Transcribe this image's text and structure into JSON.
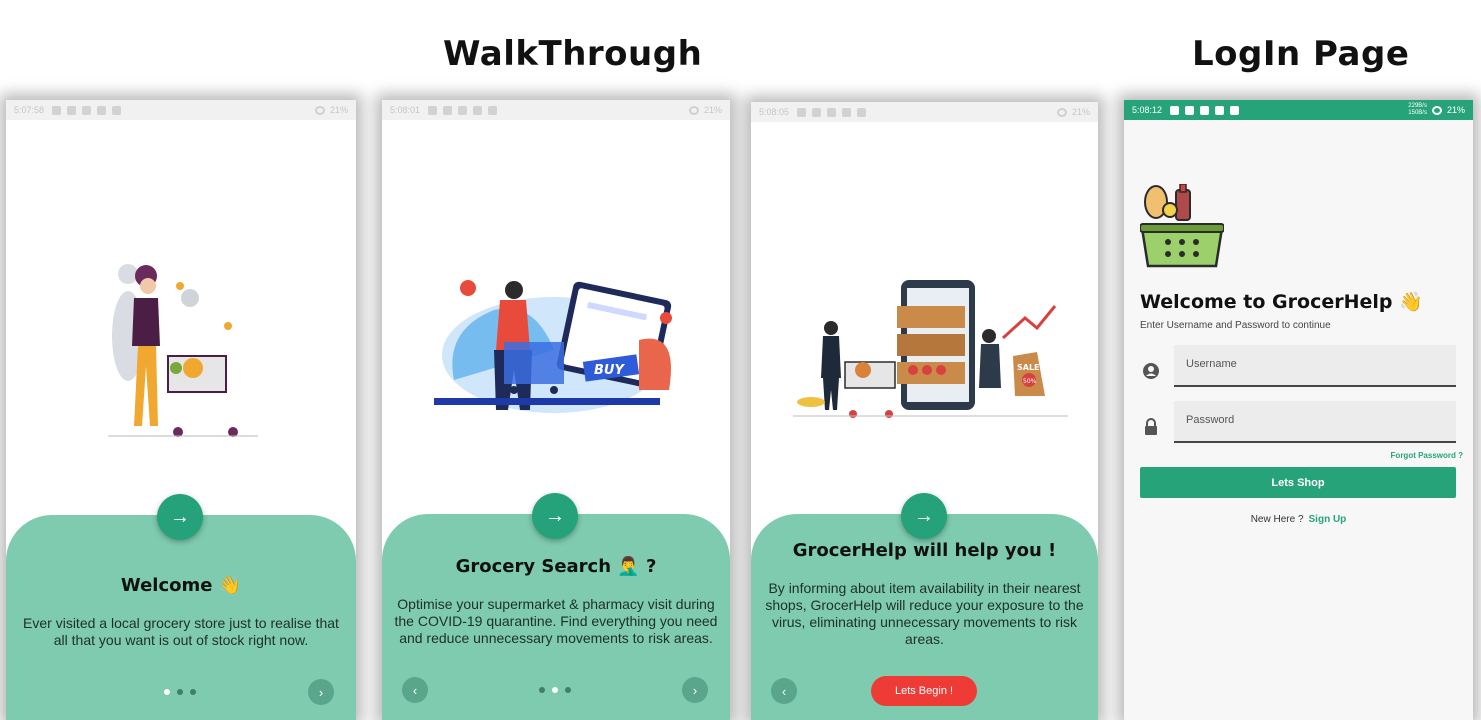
{
  "headings": {
    "walkthrough": "WalkThrough",
    "login": "LogIn Page"
  },
  "colors": {
    "accent": "#26a27b",
    "panel": "#7ecbb0",
    "begin": "#ef3b36"
  },
  "icons": {
    "next": "→",
    "prev": "‹",
    "fwd": "›"
  },
  "screens": [
    {
      "time": "5:07:58",
      "battery": "21%",
      "title": "Welcome 👋",
      "body": "Ever visited a local grocery store just to realise that all that you want is out of stock right now."
    },
    {
      "time": "5:08:01",
      "battery": "21%",
      "title": "Grocery Search 🤦‍♂️ ?",
      "body": "Optimise your supermarket & pharmacy visit during the COVID-19 quarantine. Find everything you need and reduce unnecessary movements to risk areas.",
      "illus": {
        "buy": "BUY"
      }
    },
    {
      "time": "5:08:05",
      "battery": "21%",
      "title": "GrocerHelp will help you !",
      "body": "By informing about item availability in their nearest shops, GrocerHelp will reduce your exposure to the virus, eliminating unnecessary movements to risk areas.",
      "button": "Lets Begin !",
      "illus": {
        "sale": "SALE",
        "pct": "50%"
      }
    }
  ],
  "login": {
    "time": "5:08:12",
    "battery": "21%",
    "net_up": "229B/s",
    "net_down": "150B/s",
    "title": "Welcome to GrocerHelp 👋",
    "subtitle": "Enter Username and Password to continue",
    "username_placeholder": "Username",
    "password_placeholder": "Password",
    "forgot": "Forgot Password ?",
    "shop_button": "Lets Shop",
    "new_here": "New Here ?",
    "signup": "Sign Up"
  }
}
